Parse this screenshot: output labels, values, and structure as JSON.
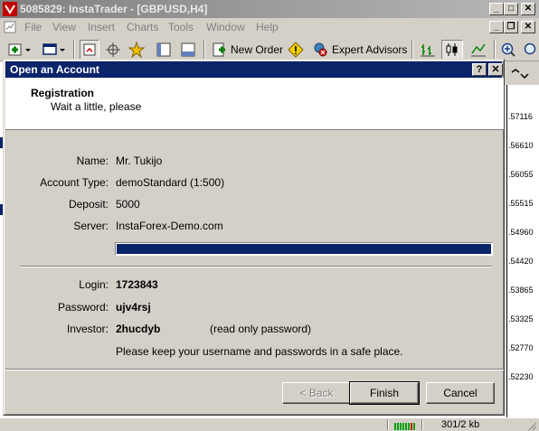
{
  "app": {
    "title": "5085829: InstaTrader - [GBPUSD,H4]"
  },
  "menu": [
    "File",
    "View",
    "Insert",
    "Charts",
    "Tools",
    "Window",
    "Help"
  ],
  "toolbar": {
    "new_order": "New Order",
    "expert_advisors": "Expert Advisors"
  },
  "prices": [
    ".57116",
    ".56610",
    ".56055",
    ".55515",
    ".54960",
    ".54420",
    ".53865",
    ".53325",
    ".52770",
    ".52230"
  ],
  "dialog": {
    "title": "Open an Account",
    "help_btn": "?",
    "close_btn": "✕",
    "header_title": "Registration",
    "header_subtitle": "Wait a little, please",
    "fields": {
      "name_label": "Name:",
      "name_value": "Mr. Tukijo",
      "account_type_label": "Account Type:",
      "account_type_value": "demoStandard (1:500)",
      "deposit_label": "Deposit:",
      "deposit_value": "5000",
      "server_label": "Server:",
      "server_value": "InstaForex-Demo.com"
    },
    "progress": 1.0,
    "credentials": {
      "login_label": "Login:",
      "login_value": "1723843",
      "password_label": "Password:",
      "password_value": "ujv4rsj",
      "investor_label": "Investor:",
      "investor_value": "2hucdyb",
      "investor_note": "(read only password)",
      "notice": "Please keep your username and passwords in a safe place."
    },
    "buttons": {
      "back": "< Back",
      "finish": "Finish",
      "cancel": "Cancel"
    }
  },
  "status": {
    "traffic": "301/2 kb"
  },
  "colors": {
    "title_active": "#0a246a",
    "window_face": "#d4d0c8",
    "progress_fill": "#0a246a"
  }
}
